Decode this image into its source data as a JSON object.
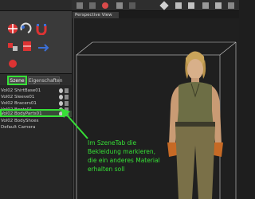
{
  "panel": {
    "tabs": [
      {
        "label": "Szene",
        "active": true
      },
      {
        "label": "Eigenschaften",
        "active": false
      }
    ],
    "scene_items": [
      {
        "label": "Vol02 ShirtBase01"
      },
      {
        "label": "Vol02 Sleeve01"
      },
      {
        "label": "Vol02 Bracers01"
      },
      {
        "label": "Vol02 Boots01"
      },
      {
        "label": "Vol02 BodyParts01",
        "selected": true
      },
      {
        "label": "Vol02 BodyShoes"
      },
      {
        "label": "Default Camera"
      }
    ]
  },
  "viewport": {
    "tab_label": "Perspective View",
    "annotation_lines": [
      "Im SzeneTab die",
      "Bekleidung markieren,",
      "die ein anderes Material",
      "erhalten soll"
    ]
  },
  "colors": {
    "highlight": "#36e036",
    "panel_bg": "#262626",
    "viewport_bg": "#1f1f1f"
  },
  "icons": [
    "move-tool-icon",
    "rotate-tool-icon",
    "scale-tool-icon",
    "magnet-tool-icon",
    "eye-icon",
    "lock-icon",
    "green-arrow-icon"
  ]
}
